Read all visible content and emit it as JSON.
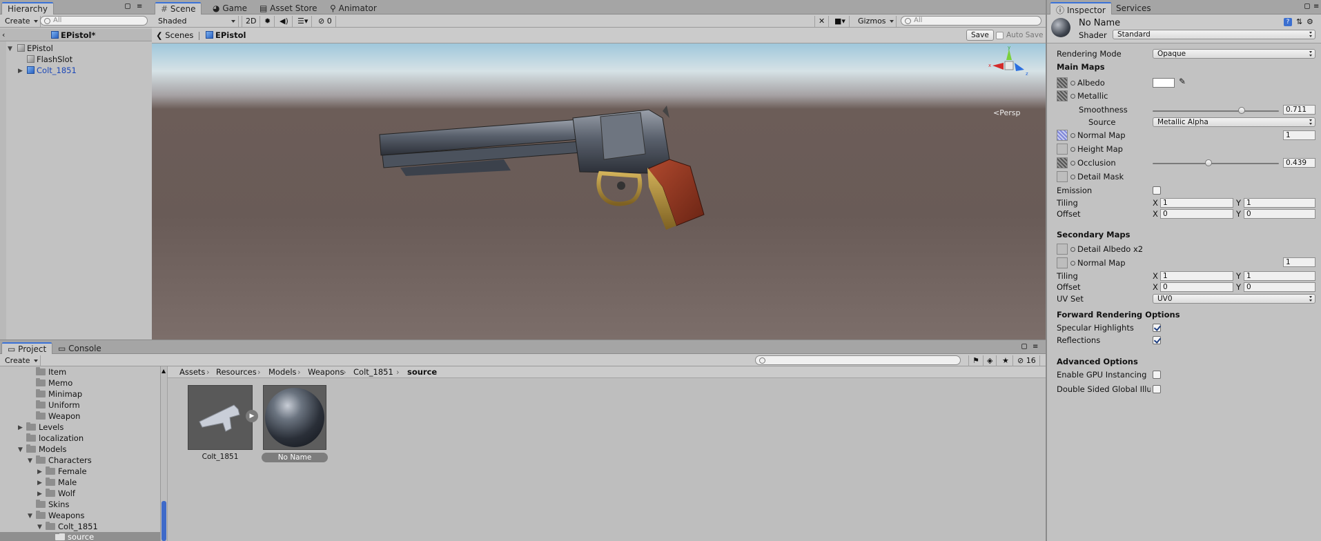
{
  "hierarchy": {
    "tab": "Hierarchy",
    "create_label": "Create",
    "search_placeholder": "All",
    "scene_root": "EPistol*",
    "items": [
      "EPistol",
      "FlashSlot",
      "Colt_1851"
    ]
  },
  "scene_tabs": [
    "Scene",
    "Game",
    "Asset Store",
    "Animator"
  ],
  "scene_toolbar": {
    "shading": "Shaded",
    "mode_2d": "2D",
    "hidden_count": "0",
    "gizmos": "Gizmos",
    "search_placeholder": "All"
  },
  "scene_bar": {
    "scenes_label": "Scenes",
    "prefab_name": "EPistol",
    "save_label": "Save",
    "auto_save_label": "Auto Save"
  },
  "viewport": {
    "persp_label": "Persp",
    "colors": {
      "sky": "#b9d6e6",
      "ground": "#6b5c58"
    }
  },
  "project": {
    "tabs": [
      "Project",
      "Console"
    ],
    "create_label": "Create",
    "hidden_count": "16",
    "tree": [
      {
        "label": "Item"
      },
      {
        "label": "Memo"
      },
      {
        "label": "Minimap"
      },
      {
        "label": "Uniform"
      },
      {
        "label": "Weapon"
      },
      {
        "label": "Levels"
      },
      {
        "label": "localization"
      },
      {
        "label": "Models"
      },
      {
        "label": "Characters"
      },
      {
        "label": "Female"
      },
      {
        "label": "Male"
      },
      {
        "label": "Wolf"
      },
      {
        "label": "Skins"
      },
      {
        "label": "Weapons"
      },
      {
        "label": "Colt_1851"
      },
      {
        "label": "source"
      }
    ],
    "breadcrumb": [
      "Assets",
      "Resources",
      "Models",
      "Weapons",
      "Colt_1851",
      "source"
    ],
    "assets": [
      "Colt_1851",
      "No Name"
    ]
  },
  "inspector": {
    "tabs": [
      "Inspector",
      "Services"
    ],
    "material_name": "No Name",
    "shader_label": "Shader",
    "shader_value": "Standard",
    "rendering_mode_label": "Rendering Mode",
    "rendering_mode_value": "Opaque",
    "main_maps_header": "Main Maps",
    "albedo": "Albedo",
    "metallic": "Metallic",
    "smoothness": "Smoothness",
    "smoothness_value": "0.711",
    "source_label": "Source",
    "source_value": "Metallic Alpha",
    "normal_map": "Normal Map",
    "normal_value": "1",
    "height_map": "Height Map",
    "occlusion": "Occlusion",
    "occlusion_value": "0.439",
    "detail_mask": "Detail Mask",
    "emission": "Emission",
    "tiling": "Tiling",
    "offset": "Offset",
    "x": "X",
    "y": "Y",
    "tiling_x": "1",
    "tiling_y": "1",
    "offset_x": "0",
    "offset_y": "0",
    "secondary_maps_header": "Secondary Maps",
    "detail_albedo": "Detail Albedo x2",
    "sec_normal_map": "Normal Map",
    "sec_normal_value": "1",
    "sec_tiling_x": "1",
    "sec_tiling_y": "1",
    "sec_offset_x": "0",
    "sec_offset_y": "0",
    "uv_set_label": "UV Set",
    "uv_set_value": "UV0",
    "forward_header": "Forward Rendering Options",
    "specular": "Specular Highlights",
    "reflections": "Reflections",
    "advanced_header": "Advanced Options",
    "gpu_instancing": "Enable GPU Instancing",
    "double_sided": "Double Sided Global Illu"
  },
  "colors": {
    "accent": "#3a72d8",
    "selection": "#3e6ac9"
  }
}
